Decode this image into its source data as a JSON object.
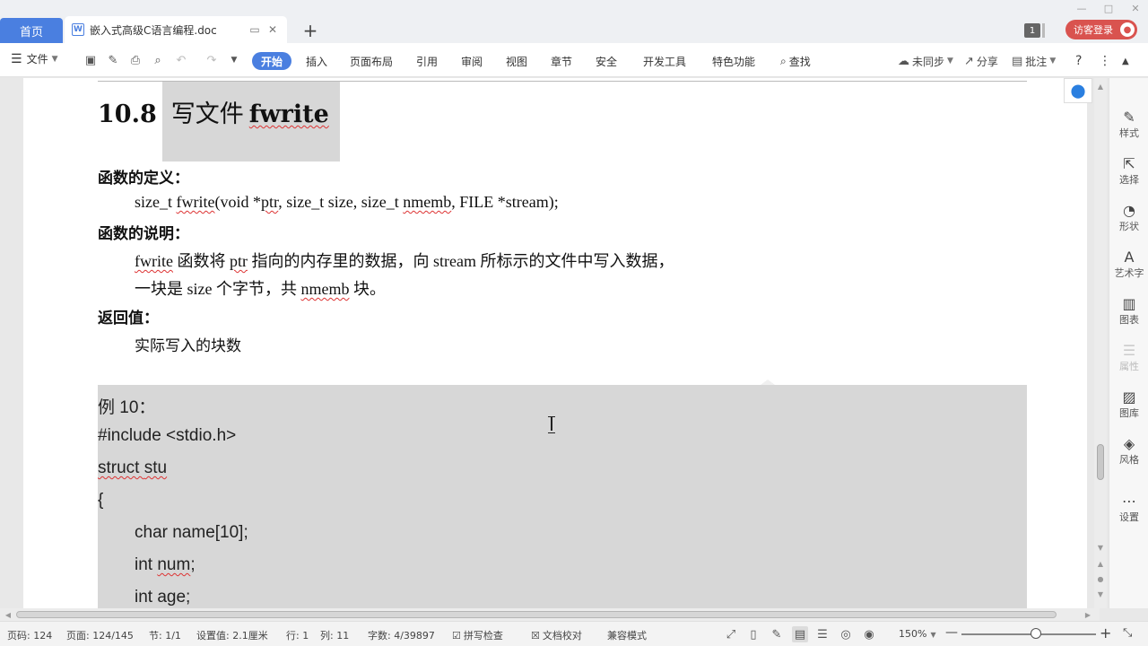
{
  "tabs": {
    "home_label": "首页",
    "doc_title": "嵌入式高级C语言编程.doc",
    "doc_icon_letter": "W",
    "tab_count": "1",
    "login_label": "访客登录"
  },
  "ribbon": {
    "file_label": "文件",
    "tabs": [
      "开始",
      "插入",
      "页面布局",
      "引用",
      "审阅",
      "视图",
      "章节",
      "安全",
      "开发工具",
      "特色功能"
    ],
    "search_label": "查找",
    "sync_label": "未同步",
    "share_label": "分享",
    "comment_label": "批注"
  },
  "document": {
    "heading_num": "10.8",
    "heading_cn": "写文件",
    "heading_fn": "fwrite",
    "def_label": "函数的定义：",
    "prototype_a": "size_t ",
    "prototype_b": "fwrite",
    "prototype_c": "(void *",
    "prototype_d": "ptr",
    "prototype_e": ", size_t size, size_t ",
    "prototype_f": "nmemb",
    "prototype_g": ", FILE *stream);",
    "desc_label": "函数的说明：",
    "desc1_a": "fwrite",
    "desc1_b": " 函数将 ",
    "desc1_c": "ptr",
    "desc1_d": " 指向的内存里的数据，向 stream 所标示的文件中写入数据，",
    "desc2_a": "一块是 size 个字节，共 ",
    "desc2_b": "nmemb",
    "desc2_c": " 块。",
    "ret_label": "返回值：",
    "ret_text": "实际写入的块数"
  },
  "code": {
    "line1": "例 10：",
    "line2": "#include <stdio.h>",
    "line3_a": "struct ",
    "line3_b": "stu",
    "line4": "{",
    "line5": "char name[10];",
    "line6_a": "int ",
    "line6_b": "num",
    "line6_c": ";",
    "line7": "int age;"
  },
  "side_panel": {
    "items": [
      "样式",
      "选择",
      "形状",
      "艺术字",
      "图表",
      "属性",
      "图库",
      "风格",
      "设置"
    ]
  },
  "status": {
    "page_code": "页码: 124",
    "pages": "页面: 124/145",
    "section": "节: 1/1",
    "setting": "设置值: 2.1厘米",
    "row": "行: 1",
    "col": "列: 11",
    "word_count": "字数: 4/39897",
    "spell_check": "拼写检查",
    "doc_proof": "文档校对",
    "compat": "兼容模式",
    "zoom": "150%"
  },
  "colors": {
    "accent": "#4a7fe0",
    "login": "#d9534f",
    "highlight": "#d7d7d7"
  }
}
